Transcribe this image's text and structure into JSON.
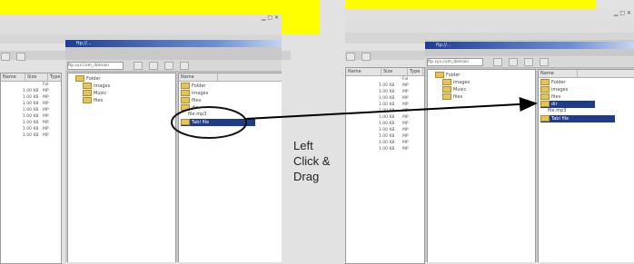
{
  "left_window": {
    "title": "ftp://...",
    "address": "ftp.sys.com_domain",
    "list_headers": [
      "Name",
      "Size",
      "Type"
    ],
    "list_rows": [
      [
        "",
        "",
        "Fol"
      ],
      [
        "",
        "1.00 KB",
        "MP"
      ],
      [
        "",
        "1.00 KB",
        "MP"
      ],
      [
        "",
        "1.00 KB",
        "MP"
      ],
      [
        "",
        "1.00 KB",
        "MP"
      ],
      [
        "",
        "1.00 KB",
        "MP"
      ],
      [
        "",
        "1.00 KB",
        "MP"
      ],
      [
        "",
        "1.00 KB",
        "MP"
      ],
      [
        "",
        "1.00 KB",
        "MP"
      ]
    ],
    "tree_items": [
      "Folder",
      "images",
      "Music",
      "files"
    ],
    "right_headers": [
      "Name"
    ],
    "right_items": [
      "Folder",
      "images",
      "files",
      "dir",
      "Music",
      "file.mp3",
      "Tabl file"
    ],
    "selected_item": "Tabl file"
  },
  "right_window": {
    "title": "ftp://...",
    "address": "ftp.sys.com_domain",
    "list_headers": [
      "Name",
      "Size",
      "Type"
    ],
    "list_rows": [
      [
        "",
        "",
        "Fol"
      ],
      [
        "",
        "1.00 KB",
        "MP"
      ],
      [
        "",
        "1.00 KB",
        "MP"
      ],
      [
        "",
        "1.00 KB",
        "MP"
      ],
      [
        "",
        "1.00 KB",
        "MP"
      ],
      [
        "",
        "1.00 KB",
        "MP"
      ],
      [
        "",
        "1.00 KB",
        "MP"
      ],
      [
        "",
        "1.00 KB",
        "MP"
      ],
      [
        "",
        "1.00 KB",
        "MP"
      ],
      [
        "",
        "1.00 KB",
        "MP"
      ],
      [
        "",
        "1.00 KB",
        "MP"
      ],
      [
        "",
        "1.00 KB",
        "MP"
      ]
    ],
    "tree_items": [
      "Folder",
      "images",
      "Music",
      "files"
    ],
    "right_headers": [
      "Name"
    ],
    "right_items": [
      "Folder",
      "images",
      "files",
      "dir",
      "Music",
      "file.mp3",
      "Tabl file"
    ],
    "selected_item": "Tabl file"
  },
  "annotation": {
    "line1": "Left",
    "line2": "Click &",
    "line3": "Drag"
  },
  "colors": {
    "highlight_yellow": "#ffff00",
    "selection_blue": "#1f3b8c",
    "titlebar_blue": "#1e3d8f"
  }
}
